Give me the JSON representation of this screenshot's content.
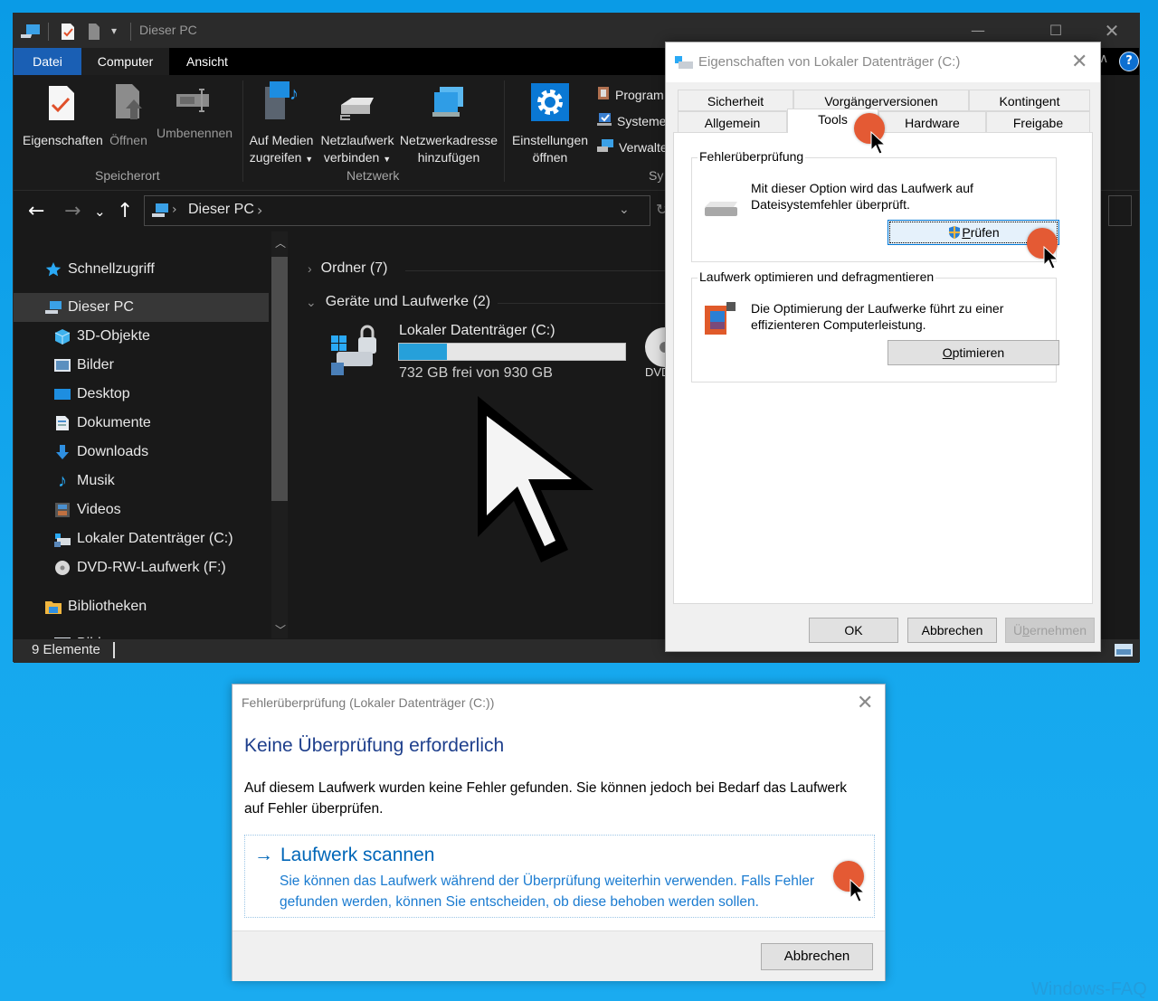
{
  "explorer": {
    "title": "Dieser PC",
    "menu_tabs": [
      "Datei",
      "Computer",
      "Ansicht"
    ],
    "ribbon": {
      "groups": [
        {
          "label": "Speicherort",
          "buttons": [
            {
              "label": "Eigenschaften",
              "icon": "properties-check-icon",
              "enabled": true
            },
            {
              "label": "Öffnen",
              "icon": "open-document-icon",
              "enabled": false
            },
            {
              "label": "Umbenennen",
              "icon": "rename-icon",
              "enabled": false
            }
          ]
        },
        {
          "label": "Netzwerk",
          "buttons": [
            {
              "label_line1": "Auf Medien",
              "label_line2": "zugreifen",
              "icon": "media-server-icon",
              "dropdown": true
            },
            {
              "label_line1": "Netzlaufwerk",
              "label_line2": "verbinden",
              "icon": "network-drive-icon",
              "dropdown": true
            },
            {
              "label_line1": "Netzwerkadresse",
              "label_line2": "hinzufügen",
              "icon": "network-location-icon",
              "dropdown": false
            }
          ]
        },
        {
          "label": "System",
          "label_visible": "Sy",
          "buttons": [
            {
              "label_line1": "Einstellungen",
              "label_line2": "öffnen",
              "icon": "settings-gear-icon"
            }
          ],
          "small_buttons": [
            {
              "label": "Program",
              "icon": "programs-icon"
            },
            {
              "label": "Systeme",
              "icon": "system-properties-icon"
            },
            {
              "label": "Verwalte",
              "icon": "manage-computer-icon"
            }
          ]
        }
      ]
    },
    "address": {
      "path": "Dieser PC"
    },
    "sidebar": {
      "items": [
        {
          "label": "Schnellzugriff",
          "icon": "star-icon",
          "level": 0
        },
        {
          "label": "Dieser PC",
          "icon": "computer-icon",
          "level": 0,
          "selected": true
        },
        {
          "label": "3D-Objekte",
          "icon": "cube-3d-icon",
          "level": 1
        },
        {
          "label": "Bilder",
          "icon": "pictures-icon",
          "level": 1
        },
        {
          "label": "Desktop",
          "icon": "desktop-icon",
          "level": 1
        },
        {
          "label": "Dokumente",
          "icon": "documents-icon",
          "level": 1
        },
        {
          "label": "Downloads",
          "icon": "download-arrow-icon",
          "level": 1
        },
        {
          "label": "Musik",
          "icon": "music-note-icon",
          "level": 1
        },
        {
          "label": "Videos",
          "icon": "videos-icon",
          "level": 1
        },
        {
          "label": "Lokaler Datenträger (C:)",
          "icon": "local-disk-icon",
          "level": 1
        },
        {
          "label": "DVD-RW-Laufwerk (F:)",
          "icon": "dvd-icon",
          "level": 1
        },
        {
          "label": "Bibliotheken",
          "icon": "library-folder-icon",
          "level": 0
        },
        {
          "label": "Bilder",
          "icon": "pictures-icon",
          "level": 1,
          "partial": true
        }
      ]
    },
    "content": {
      "groups": [
        {
          "label": "Ordner (7)",
          "expanded": false
        },
        {
          "label": "Geräte und Laufwerke (2)",
          "expanded": true
        }
      ],
      "drives": [
        {
          "name": "Lokaler Datenträger (C:)",
          "free_text": "732 GB frei von 930 GB",
          "used_fraction": 0.213
        },
        {
          "name": "DVD-RW-Laufwerk (F:)",
          "label_visible": "DVD+"
        }
      ]
    },
    "status": "9 Elemente"
  },
  "properties_dialog": {
    "title": "Eigenschaften von Lokaler Datenträger (C:)",
    "tabs_row1": [
      "Sicherheit",
      "Vorgängerversionen",
      "Kontingent"
    ],
    "tabs_row2": [
      "Allgemein",
      "Tools",
      "Hardware",
      "Freigabe"
    ],
    "active_tab": "Tools",
    "error_check": {
      "title": "Fehlerüberprüfung",
      "description_line1": "Mit dieser Option wird das Laufwerk auf",
      "description_line2": "Dateisystemfehler überprüft.",
      "button_accel": "P",
      "button_rest": "rüfen"
    },
    "optimize": {
      "title": "Laufwerk optimieren und defragmentieren",
      "description_line1": "Die Optimierung der Laufwerke führt zu einer",
      "description_line2": "effizienteren Computerleistung.",
      "button_accel": "O",
      "button_rest": "ptimieren"
    },
    "buttons": {
      "ok": "OK",
      "cancel": "Abbrechen",
      "apply_pre": "Ü",
      "apply_accel": "b",
      "apply_rest": "ernehmen"
    }
  },
  "check_dialog": {
    "title": "Fehlerüberprüfung (Lokaler Datenträger (C:))",
    "heading": "Keine Überprüfung erforderlich",
    "body": "Auf diesem Laufwerk wurden keine Fehler gefunden. Sie können jedoch bei Bedarf das Laufwerk auf Fehler überprüfen.",
    "option_title": "Laufwerk scannen",
    "option_desc": "Sie können das Laufwerk während der Überprüfung weiterhin verwenden. Falls Fehler gefunden werden, können Sie entscheiden, ob diese behoben werden sollen.",
    "cancel": "Abbrechen"
  },
  "colors": {
    "accent": "#1a5fb4",
    "drive_bar": "#26a0da",
    "marker": "#e45a34",
    "link": "#0066b8"
  },
  "watermark": "Windows-FAQ"
}
